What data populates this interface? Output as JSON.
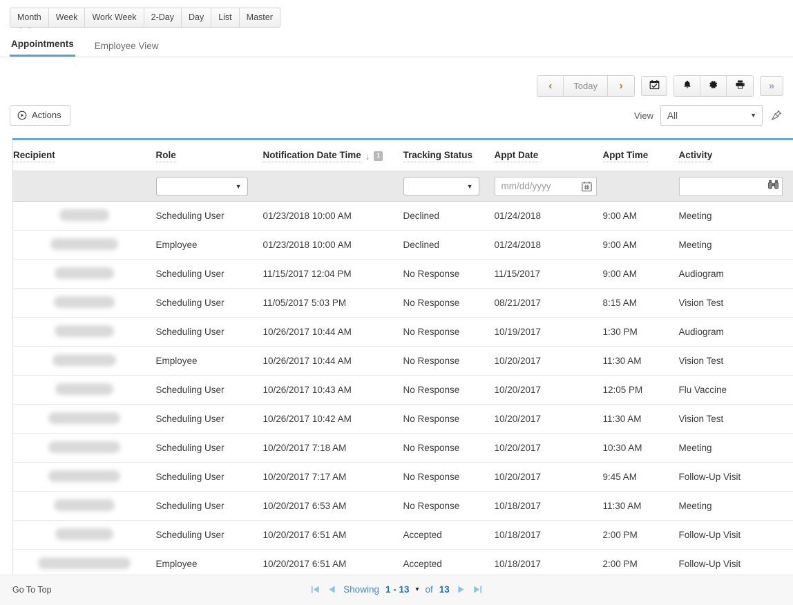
{
  "header": {
    "title": "Appointments",
    "icons": [
      {
        "name": "return-arrow-icon",
        "glyph": "↩"
      },
      {
        "name": "info-circle-icon",
        "glyph": "ⓘ"
      }
    ]
  },
  "tabs": [
    {
      "label": "Appointments",
      "active": true
    },
    {
      "label": "Employee View",
      "active": false
    }
  ],
  "view_buttons": [
    {
      "label": "Month"
    },
    {
      "label": "Week"
    },
    {
      "label": "Work Week"
    },
    {
      "label": "2-Day"
    },
    {
      "label": "Day"
    },
    {
      "label": "List"
    },
    {
      "label": "Master"
    }
  ],
  "nav": {
    "prev_label": "‹",
    "today_label": "Today",
    "next_label": "›",
    "calendar_icon": "calendar-check-icon",
    "bell_icon": "bell-icon",
    "gear_icon": "gear-icon",
    "print_icon": "printer-icon",
    "more_label": "»"
  },
  "actions": {
    "label": "Actions",
    "icon": "play-circle-icon"
  },
  "view_filter": {
    "label": "View",
    "value": "All",
    "pin_icon": "pin-icon"
  },
  "grid": {
    "columns": [
      {
        "key": "recipient",
        "label": "Recipient",
        "sorted": false
      },
      {
        "key": "role",
        "label": "Role",
        "sorted": false
      },
      {
        "key": "notification_date_time",
        "label": "Notification Date Time",
        "sorted": true,
        "sort_direction": "↓",
        "sort_order": "1"
      },
      {
        "key": "tracking_status",
        "label": "Tracking Status",
        "sorted": false
      },
      {
        "key": "appt_date",
        "label": "Appt Date",
        "sorted": false
      },
      {
        "key": "appt_time",
        "label": "Appt Time",
        "sorted": false
      },
      {
        "key": "activity",
        "label": "Activity",
        "sorted": false
      }
    ],
    "filters": {
      "role": {
        "type": "select",
        "value": ""
      },
      "tracking_status": {
        "type": "select",
        "value": ""
      },
      "appt_date": {
        "type": "date",
        "value": "",
        "placeholder": "mm/dd/yyyy",
        "icon": "calendar-picker-icon"
      },
      "activity": {
        "type": "lookup",
        "value": "",
        "icon": "binoculars-icon"
      }
    },
    "rows": [
      {
        "recipient": "",
        "recipient_width": 72,
        "role": "Scheduling User",
        "notification_date_time": "01/23/2018 10:00 AM",
        "tracking_status": "Declined",
        "appt_date": "01/24/2018",
        "appt_time": "9:00 AM",
        "activity": "Meeting"
      },
      {
        "recipient": "",
        "recipient_width": 98,
        "role": "Employee",
        "notification_date_time": "01/23/2018 10:00 AM",
        "tracking_status": "Declined",
        "appt_date": "01/24/2018",
        "appt_time": "9:00 AM",
        "activity": "Meeting"
      },
      {
        "recipient": "",
        "recipient_width": 86,
        "role": "Scheduling User",
        "notification_date_time": "11/15/2017 12:04 PM",
        "tracking_status": "No Response",
        "appt_date": "11/15/2017",
        "appt_time": "9:00 AM",
        "activity": "Audiogram"
      },
      {
        "recipient": "",
        "recipient_width": 88,
        "role": "Scheduling User",
        "notification_date_time": "11/05/2017 5:03 PM",
        "tracking_status": "No Response",
        "appt_date": "08/21/2017",
        "appt_time": "8:15 AM",
        "activity": "Vision Test"
      },
      {
        "recipient": "",
        "recipient_width": 86,
        "role": "Scheduling User",
        "notification_date_time": "10/26/2017 10:44 AM",
        "tracking_status": "No Response",
        "appt_date": "10/19/2017",
        "appt_time": "1:30 PM",
        "activity": "Audiogram"
      },
      {
        "recipient": "",
        "recipient_width": 92,
        "role": "Employee",
        "notification_date_time": "10/26/2017 10:44 AM",
        "tracking_status": "No Response",
        "appt_date": "10/20/2017",
        "appt_time": "11:30 AM",
        "activity": "Vision Test"
      },
      {
        "recipient": "",
        "recipient_width": 84,
        "role": "Scheduling User",
        "notification_date_time": "10/26/2017 10:43 AM",
        "tracking_status": "No Response",
        "appt_date": "10/20/2017",
        "appt_time": "12:05 PM",
        "activity": "Flu Vaccine"
      },
      {
        "recipient": "",
        "recipient_width": 104,
        "role": "Scheduling User",
        "notification_date_time": "10/26/2017 10:42 AM",
        "tracking_status": "No Response",
        "appt_date": "10/20/2017",
        "appt_time": "11:30 AM",
        "activity": "Vision Test"
      },
      {
        "recipient": "",
        "recipient_width": 104,
        "role": "Scheduling User",
        "notification_date_time": "10/20/2017 7:18 AM",
        "tracking_status": "No Response",
        "appt_date": "10/20/2017",
        "appt_time": "10:30 AM",
        "activity": "Meeting"
      },
      {
        "recipient": "",
        "recipient_width": 104,
        "role": "Scheduling User",
        "notification_date_time": "10/20/2017 7:17 AM",
        "tracking_status": "No Response",
        "appt_date": "10/20/2017",
        "appt_time": "9:45 AM",
        "activity": "Follow-Up Visit"
      },
      {
        "recipient": "",
        "recipient_width": 88,
        "role": "Scheduling User",
        "notification_date_time": "10/20/2017 6:53 AM",
        "tracking_status": "No Response",
        "appt_date": "10/18/2017",
        "appt_time": "11:30 AM",
        "activity": "Meeting"
      },
      {
        "recipient": "",
        "recipient_width": 84,
        "role": "Scheduling User",
        "notification_date_time": "10/20/2017 6:51 AM",
        "tracking_status": "Accepted",
        "appt_date": "10/18/2017",
        "appt_time": "2:00 PM",
        "activity": "Follow-Up Visit"
      },
      {
        "recipient": "",
        "recipient_width": 134,
        "role": "Employee",
        "notification_date_time": "10/20/2017 6:51 AM",
        "tracking_status": "Accepted",
        "appt_date": "10/18/2017",
        "appt_time": "2:00 PM",
        "activity": "Follow-Up Visit"
      }
    ]
  },
  "footer": {
    "go_to_top": "Go To Top",
    "showing_label": "Showing",
    "range": "1 - 13",
    "of_label": "of",
    "total": "13",
    "first_icon": "first-page-icon",
    "prev_icon": "prev-page-icon",
    "next_icon": "next-page-icon",
    "last_icon": "last-page-icon",
    "range_caret": "⌄"
  },
  "colors": {
    "accent": "#6aa7ce",
    "tab_underline": "#53a3d4",
    "link": "#3e8fcb",
    "filter_row_bg": "#e9e9e9",
    "footer_bg": "#f7f7f7"
  }
}
